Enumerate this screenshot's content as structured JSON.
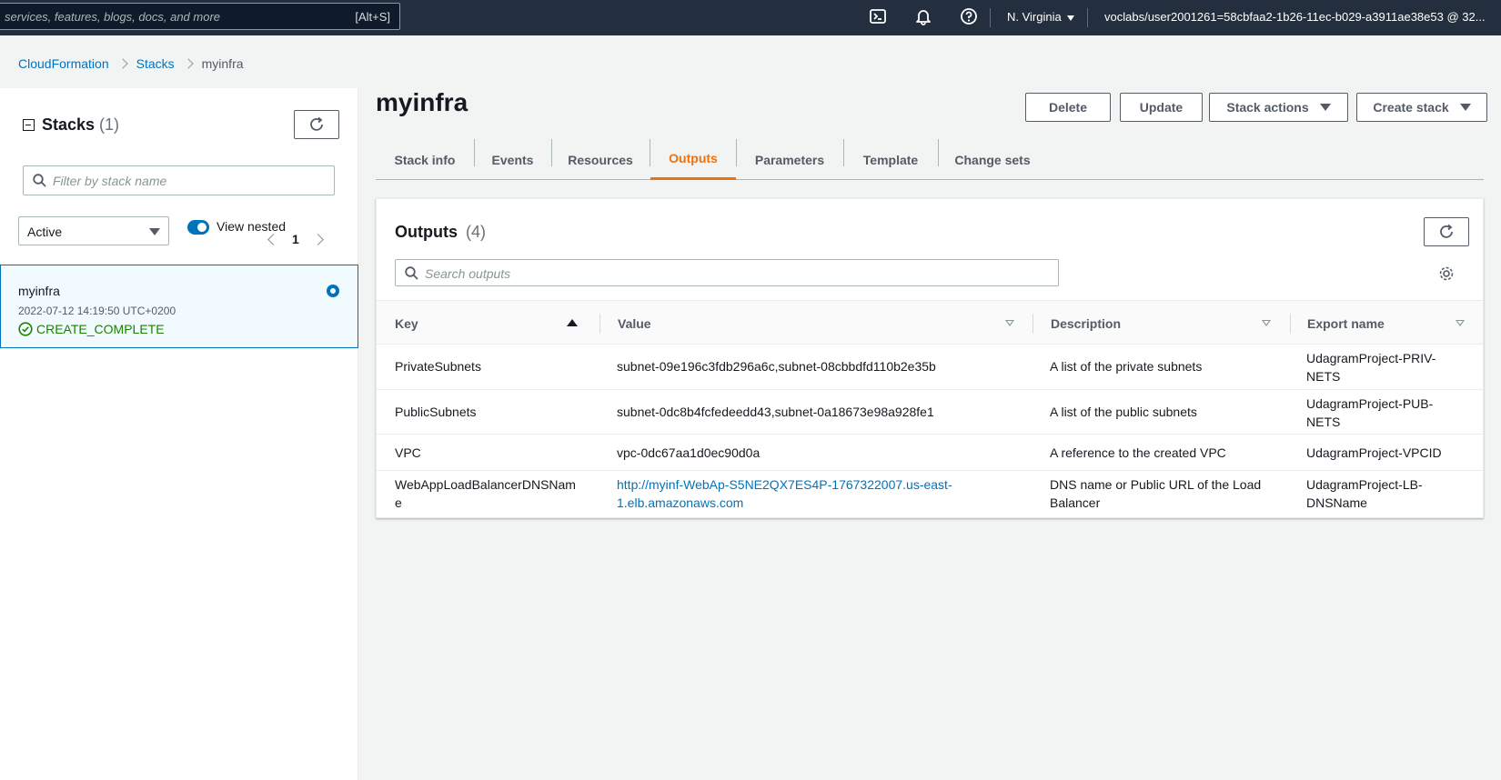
{
  "topbar": {
    "search_placeholder": "services, features, blogs, docs, and more",
    "search_shortcut": "[Alt+S]",
    "region": "N. Virginia",
    "account": "voclabs/user2001261=58cbfaa2-1b26-11ec-b029-a3911ae38e53 @ 32..."
  },
  "breadcrumb": {
    "items": [
      "CloudFormation",
      "Stacks",
      "myinfra"
    ]
  },
  "left": {
    "title": "Stacks",
    "count": "(1)",
    "filter_placeholder": "Filter by stack name",
    "status_filter": "Active",
    "view_nested_label": "View nested",
    "page": "1",
    "stack": {
      "name": "myinfra",
      "date": "2022-07-12 14:19:50 UTC+0200",
      "status": "CREATE_COMPLETE"
    }
  },
  "main": {
    "title": "myinfra",
    "buttons": {
      "delete": "Delete",
      "update": "Update",
      "stack_actions": "Stack actions",
      "create_stack": "Create stack"
    },
    "tabs": [
      "Stack info",
      "Events",
      "Resources",
      "Outputs",
      "Parameters",
      "Template",
      "Change sets"
    ],
    "active_tab": "Outputs"
  },
  "outputs": {
    "title": "Outputs",
    "count": "(4)",
    "search_placeholder": "Search outputs",
    "columns": [
      "Key",
      "Value",
      "Description",
      "Export name"
    ],
    "rows": [
      {
        "key": "PrivateSubnets",
        "value": "subnet-09e196c3fdb296a6c,subnet-08cbbdfd110b2e35b",
        "description": "A list of the private subnets",
        "export_1": "UdagramProject-PRIV-",
        "export_2": "NETS"
      },
      {
        "key": "PublicSubnets",
        "value": "subnet-0dc8b4fcfedeedd43,subnet-0a18673e98a928fe1",
        "description": "A list of the public subnets",
        "export_1": "UdagramProject-PUB-",
        "export_2": "NETS"
      },
      {
        "key": "VPC",
        "value": "vpc-0dc67aa1d0ec90d0a",
        "description": "A reference to the created VPC",
        "export_1": "UdagramProject-VPCID"
      },
      {
        "key_1": "WebAppLoadBalancerDNSNam",
        "key_2": "e",
        "value_1": "http://myinf-WebAp-S5NE2QX7ES4P-1767322007.us-east-",
        "value_2": "1.elb.amazonaws.com",
        "description_1": "DNS name or Public URL of the Load",
        "description_2": "Balancer",
        "export_1": "UdagramProject-LB-",
        "export_2": "DNSName"
      }
    ]
  },
  "colors": {
    "topbar": "#232f3e",
    "link": "#0073bb",
    "active_tab": "#ec7211",
    "success": "#1d8102"
  }
}
